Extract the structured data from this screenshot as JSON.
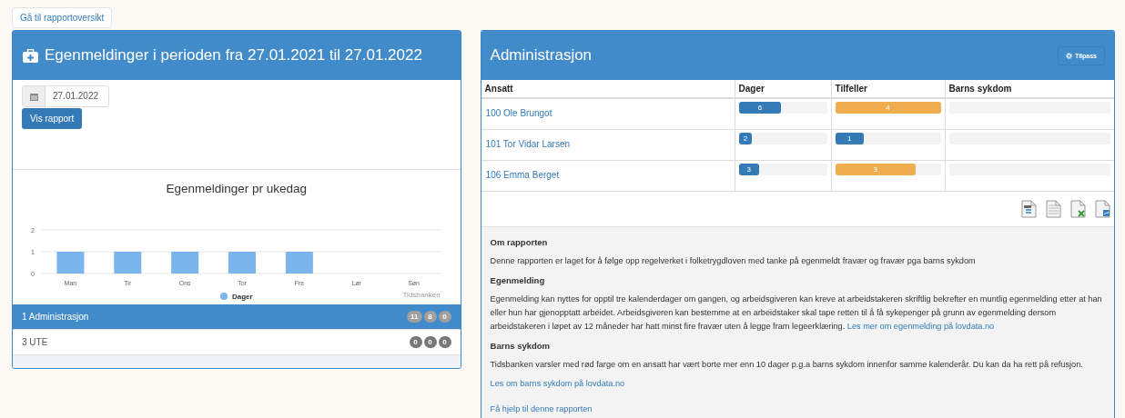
{
  "back_button": "Gå til rapportoversikt",
  "left_panel": {
    "title": "Egenmeldinger i perioden fra 27.01.2021 til 27.01.2022",
    "date_field": {
      "value": "27.01.2022"
    },
    "submit_button": "Vis rapport",
    "chart": {
      "chart_data": {
        "type": "bar",
        "title": "Egenmeldinger pr ukedag",
        "categories": [
          "Man",
          "Tir",
          "Ons",
          "Tor",
          "Fre",
          "Lør",
          "Søn"
        ],
        "series": [
          {
            "name": "Dager",
            "color": "#7cb5ec",
            "values": [
              1,
              1,
              1,
              1,
              1,
              0,
              0
            ]
          }
        ],
        "ylim": [
          0,
          2
        ],
        "yticks": [
          0,
          1,
          2
        ]
      },
      "credit": "Tidsbanken"
    },
    "departments": [
      {
        "name": "1 Administrasjon",
        "selected": true,
        "counts": [
          "11",
          "8",
          "0"
        ]
      },
      {
        "name": "3 UTE",
        "selected": false,
        "counts": [
          "0",
          "0",
          "0"
        ]
      }
    ]
  },
  "right_panel": {
    "title": "Administrasjon",
    "customize_button": "Tilpass",
    "table": {
      "columns": [
        "Ansatt",
        "Dager",
        "Tilfeller",
        "Barns sykdom"
      ],
      "rows": [
        {
          "employee": "100 Ole Brungot",
          "days": {
            "text": "6",
            "level": 0.48,
            "color": "#337ab7"
          },
          "cases": {
            "text": "4",
            "level": 1.0,
            "color": "#f0ad4e"
          }
        },
        {
          "employee": "101 Tor Vidar Larsen",
          "days": {
            "text": "2",
            "level": 0.15,
            "color": "#337ab7"
          },
          "cases": {
            "text": "1",
            "level": 0.27,
            "color": "#337ab7"
          }
        },
        {
          "employee": "106 Emma Berget",
          "days": {
            "text": "3",
            "level": 0.23,
            "color": "#337ab7"
          },
          "cases": {
            "text": "3",
            "level": 0.76,
            "color": "#f0ad4e"
          }
        }
      ]
    },
    "info": {
      "sections": [
        {
          "heading": "Om rapporten",
          "text": "Denne rapporten er laget for å følge opp regelverket i folketrygdloven med tanke på egenmeldt fravær og fravær pga barns sykdom"
        },
        {
          "heading": "Egenmelding",
          "text": "Egenmelding kan nyttes for opptil tre kalenderdager om gangen, og arbeidsgiveren kan kreve at arbeidstakeren skriftlig bekrefter en muntlig egenmelding etter at han eller hun har gjenopptatt arbeidet. Arbeidsgiveren kan bestemme at en arbeidstaker skal tape retten til å få sykepenger på grunn av egenmelding dersom arbeidstakeren i løpet av 12 måneder har hatt minst fire fravær uten å legge fram legeerklæring.",
          "link": "Les mer om egenmelding på lovdata.no"
        },
        {
          "heading": "Barns sykdom",
          "text": "Tidsbanken varsler med rød farge om en ansatt har vært borte mer enn 10 dager p.g.a barns sykdom innenfor samme kalenderår. Du kan da ha rett på refusjon."
        }
      ],
      "links": [
        "Les om barns sykdom på lovdata.no",
        "Få hjelp til denne rapporten"
      ]
    }
  }
}
